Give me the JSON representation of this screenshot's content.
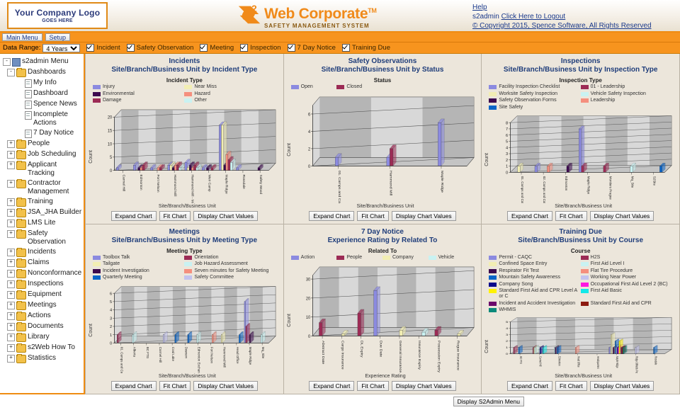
{
  "header": {
    "logo_line1": "Your Company Logo",
    "logo_line2": "GOES HERE",
    "brand_main": "Web Corporate",
    "brand_tm": "TM",
    "brand_sub": "SAFETY MANAGEMENT SYSTEM",
    "brand_mark_label": "s2-logo-icon",
    "help": "Help",
    "user": "s2admin",
    "logout": "Click Here to Logout",
    "copyright": "© Copyright 2015, Spence Software, All Rights Reserved"
  },
  "tabs": [
    {
      "label": "Main Menu"
    },
    {
      "label": "Setup"
    }
  ],
  "toolbar": {
    "date_range_label": "Data Range:",
    "date_range_value": "4 Years",
    "date_range_options": [
      "4 Years"
    ],
    "filters": [
      {
        "label": "Incident",
        "checked": true
      },
      {
        "label": "Safety Observation",
        "checked": true
      },
      {
        "label": "Meeting",
        "checked": true
      },
      {
        "label": "Inspection",
        "checked": true
      },
      {
        "label": "7 Day Notice",
        "checked": true
      },
      {
        "label": "Training Due",
        "checked": true
      }
    ]
  },
  "sidebar": {
    "items": [
      {
        "label": "s2admin Menu",
        "level": 0,
        "expander": "-",
        "icon": "root-icon"
      },
      {
        "label": "Dashboards",
        "level": 1,
        "expander": "-",
        "icon": "folder-icon"
      },
      {
        "label": "My Info",
        "level": 2,
        "expander": "",
        "icon": "page-icon"
      },
      {
        "label": "Dashboard",
        "level": 2,
        "expander": "",
        "icon": "page-icon"
      },
      {
        "label": "Spence News",
        "level": 2,
        "expander": "",
        "icon": "page-icon"
      },
      {
        "label": "Incomplete Actions",
        "level": 2,
        "expander": "",
        "icon": "page-icon"
      },
      {
        "label": "7 Day Notice",
        "level": 2,
        "expander": "",
        "icon": "page-icon"
      },
      {
        "label": "People",
        "level": 1,
        "expander": "+",
        "icon": "folder-icon"
      },
      {
        "label": "Job Scheduling",
        "level": 1,
        "expander": "+",
        "icon": "folder-icon"
      },
      {
        "label": "Applicant Tracking",
        "level": 1,
        "expander": "+",
        "icon": "folder-icon"
      },
      {
        "label": "Contractor Management",
        "level": 1,
        "expander": "+",
        "icon": "folder-icon"
      },
      {
        "label": "Training",
        "level": 1,
        "expander": "+",
        "icon": "folder-icon"
      },
      {
        "label": "JSA_JHA Builder",
        "level": 1,
        "expander": "+",
        "icon": "folder-icon"
      },
      {
        "label": "LMS Lite",
        "level": 1,
        "expander": "+",
        "icon": "folder-icon"
      },
      {
        "label": "Safety Observation",
        "level": 1,
        "expander": "+",
        "icon": "folder-icon"
      },
      {
        "label": "Incidents",
        "level": 1,
        "expander": "+",
        "icon": "folder-icon"
      },
      {
        "label": "Claims",
        "level": 1,
        "expander": "+",
        "icon": "folder-icon"
      },
      {
        "label": "Nonconformance",
        "level": 1,
        "expander": "+",
        "icon": "folder-icon"
      },
      {
        "label": "Inspections",
        "level": 1,
        "expander": "+",
        "icon": "folder-icon"
      },
      {
        "label": "Equipment",
        "level": 1,
        "expander": "+",
        "icon": "folder-icon"
      },
      {
        "label": "Meetings",
        "level": 1,
        "expander": "+",
        "icon": "folder-icon"
      },
      {
        "label": "Actions",
        "level": 1,
        "expander": "+",
        "icon": "folder-icon"
      },
      {
        "label": "Documents",
        "level": 1,
        "expander": "+",
        "icon": "folder-icon"
      },
      {
        "label": "Library",
        "level": 1,
        "expander": "+",
        "icon": "folder-icon"
      },
      {
        "label": "s2Web How To",
        "level": 1,
        "expander": "+",
        "icon": "folder-icon"
      },
      {
        "label": "Statistics",
        "level": 1,
        "expander": "+",
        "icon": "folder-icon"
      }
    ]
  },
  "chart_buttons": {
    "expand": "Expand Chart",
    "fit": "Fit Chart",
    "values": "Display Chart Values"
  },
  "footer": {
    "display_menu_button": "Display S2Admin Menu"
  },
  "chart_data": [
    {
      "id": "incidents",
      "type": "bar",
      "title": "Incidents",
      "subtitle": "Site/Branch/Business Unit by Incident Type",
      "legend_title": "Incident Type",
      "legend_position": "top",
      "xlabel": "Site/Branch/Business Unit",
      "ylabel": "Count",
      "ylim": [
        0,
        20
      ],
      "yticks": [
        0,
        5,
        10,
        15,
        20
      ],
      "grid": true,
      "categories": [
        "Carmel Hill",
        "Edmonton",
        "Fort Nelson",
        "Hammond Mill",
        "Hammond Mill - McMurray Shed",
        "Weir Camp",
        "Maple Ridge",
        "Rossdale",
        "Safety Wood"
      ],
      "series": [
        {
          "name": "Injury",
          "color": "#8b8ae0",
          "values": [
            1,
            2,
            1,
            2,
            3,
            1,
            17,
            1,
            0
          ]
        },
        {
          "name": "Near Miss",
          "color": "#f2eeb3",
          "values": [
            0,
            0,
            0,
            2,
            1,
            0,
            17,
            0,
            0
          ]
        },
        {
          "name": "Environmental",
          "color": "#3d0a4e",
          "values": [
            0,
            1,
            0,
            1,
            2,
            1,
            2,
            0,
            1
          ]
        },
        {
          "name": "Hazard",
          "color": "#f58f7e",
          "values": [
            0,
            1,
            1,
            2,
            1,
            0,
            6,
            0,
            0
          ]
        },
        {
          "name": "Damage",
          "color": "#9c2b55",
          "values": [
            0,
            2,
            1,
            2,
            2,
            1,
            4,
            0,
            0
          ]
        },
        {
          "name": "Other",
          "color": "#c9f2f2",
          "values": [
            0,
            0,
            0,
            1,
            1,
            0,
            3,
            0,
            0
          ]
        }
      ]
    },
    {
      "id": "safety-observations",
      "type": "bar",
      "title": "Safety Observations",
      "subtitle": "Site/Branch/Business Unit by Status",
      "legend_title": "Status",
      "legend_position": "top",
      "xlabel": "Site/Branch/Business Unit",
      "ylabel": "Count",
      "ylim": [
        0,
        7
      ],
      "yticks": [
        0,
        2,
        4,
        6
      ],
      "grid": true,
      "categories": [
        "01. Camps and Catering",
        "Hammond Mill",
        "Maple Ridge"
      ],
      "series": [
        {
          "name": "Open",
          "color": "#8b8ae0",
          "values": [
            1,
            1,
            5
          ]
        },
        {
          "name": "Closed",
          "color": "#9c2b55",
          "values": [
            0,
            2,
            0
          ]
        }
      ]
    },
    {
      "id": "inspections",
      "type": "bar",
      "title": "Inspections",
      "subtitle": "Site/Branch/Business Unit by Inspection Type",
      "legend_title": "Inspection Type",
      "legend_position": "top",
      "xlabel": "Site/Branch/Business Unit",
      "ylabel": "Count",
      "ylim": [
        0,
        8
      ],
      "yticks": [
        0,
        1,
        2,
        3,
        4,
        5,
        6,
        7,
        8
      ],
      "grid": true,
      "categories": [
        "01. Camps and Catering",
        "02. Camps and Catering - Blackwood",
        "Edmonton",
        "Maple Ridge",
        "Montiers Prague",
        "Mq_Site",
        "S2Site"
      ],
      "series": [
        {
          "name": "Facility Inspection Checklist",
          "color": "#8b8ae0",
          "values": [
            0,
            1,
            0,
            7,
            0,
            0,
            0
          ]
        },
        {
          "name": "01 - Leadership",
          "color": "#9c2b55",
          "values": [
            0,
            0,
            0,
            1,
            1,
            0,
            0
          ]
        },
        {
          "name": "Worksite Safety Inspection",
          "color": "#f2eeb3",
          "values": [
            1,
            0,
            0,
            0,
            0,
            0,
            0
          ]
        },
        {
          "name": "Vehicle Safety Inspection",
          "color": "#c9f2f2",
          "values": [
            0,
            0,
            0,
            0,
            0,
            1,
            0
          ]
        },
        {
          "name": "Safety Observation Forms",
          "color": "#3d0a4e",
          "values": [
            0,
            0,
            1,
            0,
            0,
            0,
            0
          ]
        },
        {
          "name": "Leadership",
          "color": "#f58f7e",
          "values": [
            0,
            1,
            0,
            0,
            0,
            0,
            0
          ]
        },
        {
          "name": "Site Safety",
          "color": "#0a65c8",
          "values": [
            0,
            0,
            0,
            0,
            0,
            0,
            1
          ]
        }
      ]
    },
    {
      "id": "meetings",
      "type": "bar",
      "title": "Meetings",
      "subtitle": "Site/Branch/Business Unit by Meeting Type",
      "legend_title": "Meeting Type",
      "legend_position": "top",
      "xlabel": "Site/Branch/Business Unit",
      "ylabel": "Count",
      "ylim": [
        0,
        6
      ],
      "yticks": [
        0,
        1,
        2,
        3,
        4,
        5,
        6
      ],
      "grid": true,
      "categories": [
        "01. Camps and Catering - US",
        "Alberta",
        "BC FTG",
        "Carmel Hill",
        "Coal Lake",
        "Dawson",
        "Edmonton Exchange",
        "Fort Nelson",
        "Hammond Mill",
        "Head Office",
        "Maple Ridge",
        "Mq_Site"
      ],
      "series": [
        {
          "name": "Toolbox Talk",
          "color": "#8b8ae0",
          "values": [
            0,
            0,
            0,
            0,
            0,
            0,
            0,
            0,
            0,
            0,
            5,
            0
          ]
        },
        {
          "name": "Orientation",
          "color": "#9c2b55",
          "values": [
            1,
            0,
            0,
            0,
            0,
            0,
            0,
            0,
            0,
            0,
            2,
            0
          ]
        },
        {
          "name": "Tailgate",
          "color": "#f2eeb3",
          "values": [
            0,
            0,
            0,
            0,
            0,
            0,
            0,
            0,
            1,
            0,
            0,
            0
          ]
        },
        {
          "name": "Job Hazard Assessment",
          "color": "#c9f2f2",
          "values": [
            0,
            1,
            0,
            0,
            0,
            0,
            1,
            0,
            0,
            0,
            0,
            1
          ]
        },
        {
          "name": "Incident Investigation",
          "color": "#3d0a4e",
          "values": [
            0,
            0,
            0,
            0,
            0,
            0,
            0,
            0,
            0,
            0,
            1,
            0
          ]
        },
        {
          "name": "Seven minutes for Safety Meeting",
          "color": "#f58f7e",
          "values": [
            0,
            0,
            0,
            0,
            0,
            0,
            0,
            1,
            0,
            0,
            0,
            0
          ]
        },
        {
          "name": "Quarterly Meeting",
          "color": "#0a65c8",
          "values": [
            0,
            0,
            0,
            0,
            1,
            1,
            0,
            0,
            0,
            1,
            0,
            0
          ]
        },
        {
          "name": "Safety Committee",
          "color": "#c3c3ee",
          "values": [
            0,
            0,
            0,
            1,
            0,
            0,
            0,
            0,
            0,
            0,
            0,
            0
          ]
        }
      ]
    },
    {
      "id": "seven-day-notice",
      "type": "bar",
      "title": "7 Day Notice",
      "subtitle": "Experience Rating by Related To",
      "legend_title": "Related To",
      "legend_position": "top",
      "xlabel": "Experience Rating",
      "ylabel": "Count",
      "ylim": [
        0,
        32
      ],
      "yticks": [
        0,
        10,
        20,
        30
      ],
      "grid": true,
      "categories": [
        "Abstract Date",
        "Cargo Insurance",
        "DL Expiry",
        "Due Date",
        "General Insurance",
        "Insurance Expiry",
        "Possession Expiry",
        "Rogue Insurance"
      ],
      "series": [
        {
          "name": "Action",
          "color": "#8b8ae0",
          "values": [
            0,
            0,
            0,
            24,
            0,
            0,
            0,
            0
          ]
        },
        {
          "name": "People",
          "color": "#9c2b55",
          "values": [
            7,
            0,
            12,
            0,
            0,
            0,
            3,
            0
          ]
        },
        {
          "name": "Company",
          "color": "#f2eeb3",
          "values": [
            0,
            1,
            0,
            0,
            3,
            0,
            0,
            1
          ]
        },
        {
          "name": "Vehicle",
          "color": "#c9f2f2",
          "values": [
            0,
            0,
            0,
            0,
            0,
            2,
            0,
            0
          ]
        }
      ]
    },
    {
      "id": "training-due",
      "type": "bar",
      "title": "Training Due",
      "subtitle": "Site/Branch/Business Unit by Course",
      "legend_title": "Course",
      "legend_position": "top",
      "xlabel": "Site/Branch/Business Unit",
      "ylabel": "Count",
      "ylim": [
        0,
        5
      ],
      "yticks": [
        0,
        1,
        2,
        3,
        4,
        5
      ],
      "grid": true,
      "categories": [
        "BC FTG",
        "Carmel Hill",
        "Edmonton",
        "Head Office",
        "Headquarters",
        "Maple Ridge",
        "Ridge Oilfields Projects",
        "Rossdale"
      ],
      "series": [
        {
          "name": "Permit - CAQC",
          "color": "#8b8ae0",
          "values": [
            0,
            0,
            0,
            0,
            0,
            1,
            0,
            0
          ]
        },
        {
          "name": "H2S",
          "color": "#9c2b55",
          "values": [
            1,
            1,
            0,
            0,
            0,
            0,
            0,
            0
          ]
        },
        {
          "name": "Confined Space Entry",
          "color": "#f2eeb3",
          "values": [
            0,
            1,
            0,
            0,
            0,
            3,
            0,
            0
          ]
        },
        {
          "name": "First Aid Level I",
          "color": "#c9f2f2",
          "values": [
            0,
            1,
            1,
            0,
            0,
            0,
            0,
            0
          ]
        },
        {
          "name": "Respirator Fit Test",
          "color": "#3d0a4e",
          "values": [
            0,
            0,
            1,
            0,
            0,
            1,
            0,
            0
          ]
        },
        {
          "name": "Flat Tire Procedure",
          "color": "#f58f7e",
          "values": [
            0,
            0,
            0,
            1,
            0,
            0,
            0,
            0
          ]
        },
        {
          "name": "Mountain Safety Awareness",
          "color": "#0a65c8",
          "values": [
            1,
            0,
            1,
            0,
            0,
            2,
            0,
            1
          ]
        },
        {
          "name": "Working Near Power",
          "color": "#c3c3ee",
          "values": [
            0,
            0,
            0,
            0,
            0,
            1,
            1,
            0
          ]
        },
        {
          "name": "Company Song",
          "color": "#0a0a8c",
          "values": [
            0,
            1,
            0,
            0,
            0,
            1,
            0,
            0
          ]
        },
        {
          "name": "Occupational First Aid Level 2 (BC)",
          "color": "#ff1ae0",
          "values": [
            0,
            0,
            0,
            0,
            0,
            1,
            0,
            0
          ]
        },
        {
          "name": "Standard First Aid and CPR Level A or C",
          "color": "#fff200",
          "values": [
            0,
            0,
            0,
            0,
            0,
            2,
            0,
            0
          ]
        },
        {
          "name": "First Aid Basic",
          "color": "#13e8e8",
          "values": [
            0,
            1,
            0,
            0,
            0,
            0,
            0,
            0
          ]
        },
        {
          "name": "Incident and Accident Investigation",
          "color": "#6b0a6b",
          "values": [
            0,
            0,
            0,
            0,
            0,
            1,
            0,
            0
          ]
        },
        {
          "name": "Standard First Aid and CPR",
          "color": "#8c1a10",
          "values": [
            0,
            0,
            0,
            0,
            0,
            1,
            0,
            0
          ]
        },
        {
          "name": "WHMIS",
          "color": "#0b8a7a",
          "values": [
            0,
            0,
            0,
            0,
            0,
            1,
            0,
            0
          ]
        }
      ]
    }
  ]
}
